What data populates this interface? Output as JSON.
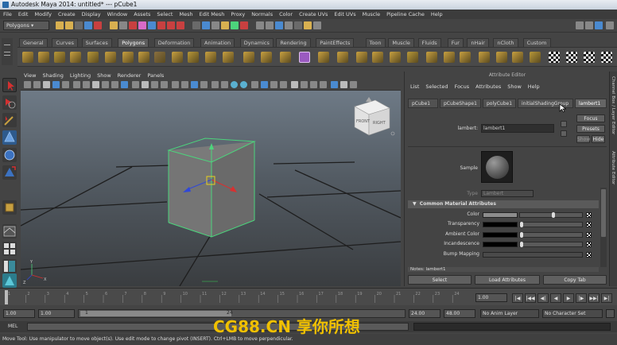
{
  "window": {
    "title": "Autodesk Maya 2014: untitled*   ---   pCube1"
  },
  "menubar": [
    "File",
    "Edit",
    "Modify",
    "Create",
    "Display",
    "Window",
    "Assets",
    "Select",
    "Mesh",
    "Edit Mesh",
    "Proxy",
    "Normals",
    "Color",
    "Create UVs",
    "Edit UVs",
    "Muscle",
    "Pipeline Cache",
    "Help"
  ],
  "statusline": {
    "mode": "Polygons"
  },
  "shelf": {
    "tabs": [
      "General",
      "Curves",
      "Surfaces",
      "Polygons",
      "Deformation",
      "Animation",
      "Dynamics",
      "Rendering",
      "PaintEffects",
      "Toon",
      "Muscle",
      "Fluids",
      "Fur",
      "nHair",
      "nCloth",
      "Custom"
    ],
    "active_tab": "Polygons"
  },
  "viewport": {
    "menu": [
      "View",
      "Shading",
      "Lighting",
      "Show",
      "Renderer",
      "Panels"
    ],
    "viewcube_front": "FRONT",
    "viewcube_right": "RIGHT",
    "axis_y": "Y",
    "axis_x": "X",
    "axis_z": "Z"
  },
  "attribute_editor": {
    "title": "Attribute Editor",
    "menu": [
      "List",
      "Selected",
      "Focus",
      "Attributes",
      "Show",
      "Help"
    ],
    "node_tabs": [
      "pCube1",
      "pCubeShape1",
      "polyCube1",
      "initialShadingGroup",
      "lambert1"
    ],
    "active_tab": "lambert1",
    "focus_label": "Focus",
    "presets_label": "Presets",
    "show_label": "Show",
    "hide_label": "Hide",
    "lambert_label": "lambert:",
    "lambert_value": "lambert1",
    "sample_label": "Sample",
    "type_label": "Type",
    "type_value": "Lambert",
    "section_common": "Common Material Attributes",
    "attributes": [
      {
        "label": "Color",
        "swatch": "#8c8c8c"
      },
      {
        "label": "Transparency",
        "swatch": "#000000"
      },
      {
        "label": "Ambient Color",
        "swatch": "#000000"
      },
      {
        "label": "Incandescence",
        "swatch": "#000000"
      },
      {
        "label": "Bump Mapping",
        "swatch": ""
      }
    ],
    "notes_label": "Notes: lambert1",
    "buttons": {
      "select": "Select",
      "load": "Load Attributes",
      "copy": "Copy Tab"
    }
  },
  "right_strip": [
    "Channel Box / Layer Editor",
    "Attribute Editor"
  ],
  "timeslider": {
    "ticks": [
      "1",
      "2",
      "3",
      "4",
      "5",
      "6",
      "7",
      "8",
      "9",
      "10",
      "11",
      "12",
      "13",
      "14",
      "15",
      "16",
      "17",
      "18",
      "19",
      "20",
      "21",
      "22",
      "23",
      "24"
    ],
    "current_frame": "1.00"
  },
  "range": {
    "start": "1.00",
    "start2": "1.00",
    "range_start": "1",
    "range_end": "24",
    "end": "24.00",
    "end2": "48.00",
    "anim_layer": "No Anim Layer",
    "char_set": "No Character Set"
  },
  "mel": {
    "label": "MEL"
  },
  "helpline": "Move Tool: Use manipulator to move object(s). Use edit mode to change pivot (INSERT). Ctrl+LMB to move perpendicular.",
  "watermark": "CG88.CN 享你所想",
  "colors": {
    "accent": "#d86bc8",
    "selection": "#4cd47c",
    "watermark": "#f0c000"
  }
}
